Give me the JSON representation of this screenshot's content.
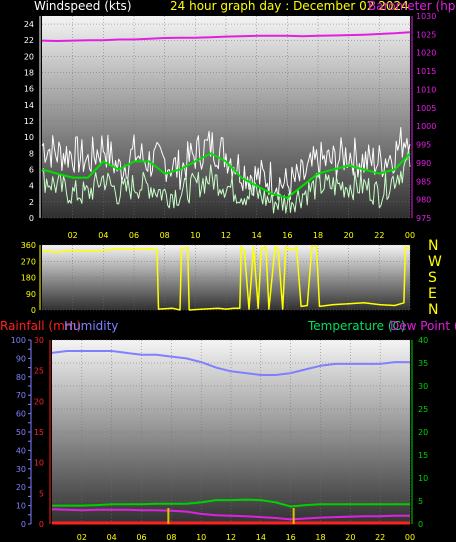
{
  "header": {
    "left_title": "Windspeed (kts)",
    "center_title": "24 hour graph day : December 02 2024",
    "right_title": "Barometer (hpa)"
  },
  "panel3_labels": {
    "rainfall": "Rainfall (mm)",
    "humidity": "Humidity",
    "temperature": "Temperature (C)",
    "dew_point": "Dew Point (C)"
  },
  "x_ticks": [
    "02",
    "04",
    "06",
    "08",
    "10",
    "12",
    "14",
    "16",
    "18",
    "20",
    "22",
    "00"
  ],
  "compass": [
    "N",
    "W",
    "S",
    "E",
    "N"
  ],
  "colors": {
    "wind_gust": "#ffffff",
    "wind_avg": "#c8ffc8",
    "wind_trend": "#00e000",
    "barometer": "#e020e0",
    "direction": "#ffff00",
    "humidity": "#8080ff",
    "temperature": "#00d000",
    "dewpoint": "#e020e0",
    "rainfall": "#ff2020"
  },
  "chart_data": [
    {
      "type": "line",
      "name": "wind-and-barometer",
      "x_hours": [
        0,
        1,
        2,
        3,
        4,
        5,
        6,
        7,
        8,
        9,
        10,
        11,
        12,
        13,
        14,
        15,
        16,
        17,
        18,
        19,
        20,
        21,
        22,
        23,
        24
      ],
      "series": [
        {
          "name": "Windspeed (kts)",
          "axis": "left",
          "values": [
            9,
            8,
            8,
            7,
            9,
            6,
            8,
            7,
            7,
            6,
            8,
            9,
            8,
            6,
            5,
            5,
            4,
            5,
            7,
            7,
            8,
            7,
            7,
            8,
            11
          ]
        },
        {
          "name": "Windspeed (kts)",
          "axis": "left",
          "values": [
            5,
            4,
            3,
            3,
            5,
            3,
            4,
            4,
            3,
            3,
            4,
            5,
            4,
            3,
            3,
            2,
            2,
            3,
            4,
            4,
            4,
            4,
            3,
            5,
            7
          ]
        },
        {
          "name": "Windspeed (kts)",
          "axis": "left",
          "values": [
            6,
            5.5,
            5,
            5,
            7,
            6,
            7,
            7,
            5.5,
            6,
            7,
            8,
            7,
            5,
            4,
            3,
            2.5,
            4,
            5.5,
            6,
            6.5,
            6,
            5.5,
            6,
            8
          ]
        },
        {
          "name": "Barometer (hpa)",
          "axis": "right",
          "values": [
            1023.3,
            1023.2,
            1023.3,
            1023.4,
            1023.4,
            1023.6,
            1023.6,
            1023.8,
            1024.0,
            1024.1,
            1024.1,
            1024.2,
            1024.4,
            1024.5,
            1024.6,
            1024.6,
            1024.6,
            1024.5,
            1024.6,
            1024.7,
            1024.8,
            1024.9,
            1025.1,
            1025.3,
            1025.6
          ]
        }
      ],
      "ylim_left": [
        0,
        25
      ],
      "yticks_left": [
        0,
        2,
        4,
        6,
        8,
        10,
        12,
        14,
        16,
        18,
        20,
        22,
        24
      ],
      "ylim_right": [
        975,
        1030
      ],
      "yticks_right": [
        975,
        980,
        985,
        990,
        995,
        1000,
        1005,
        1010,
        1015,
        1020,
        1025,
        1030
      ]
    },
    {
      "type": "line",
      "name": "wind-direction",
      "series": [
        {
          "name": "Wind direction",
          "values": [
            [
              0,
              330
            ],
            [
              1,
              320
            ],
            [
              2,
              330
            ],
            [
              3,
              325
            ],
            [
              4,
              330
            ],
            [
              5,
              340
            ],
            [
              6,
              335
            ],
            [
              7,
              340
            ],
            [
              7.5,
              335
            ],
            [
              7.6,
              5
            ],
            [
              8.5,
              10
            ],
            [
              9,
              0
            ],
            [
              9.1,
              340
            ],
            [
              9.5,
              345
            ],
            [
              9.6,
              0
            ],
            [
              10.5,
              5
            ],
            [
              11.5,
              10
            ],
            [
              12,
              5
            ],
            [
              12.5,
              10
            ],
            [
              12.9,
              10
            ],
            [
              13,
              350
            ],
            [
              13.2,
              330
            ],
            [
              13.5,
              5
            ],
            [
              13.8,
              350
            ],
            [
              14.1,
              10
            ],
            [
              14.3,
              340
            ],
            [
              14.6,
              350
            ],
            [
              14.8,
              5
            ],
            [
              15.2,
              350
            ],
            [
              15.4,
              340
            ],
            [
              15.7,
              5
            ],
            [
              15.9,
              350
            ],
            [
              16.3,
              330
            ],
            [
              16.6,
              350
            ],
            [
              16.9,
              20
            ],
            [
              17.3,
              25
            ],
            [
              17.6,
              355
            ],
            [
              17.9,
              350
            ],
            [
              18.1,
              20
            ],
            [
              19,
              30
            ],
            [
              20,
              35
            ],
            [
              21,
              40
            ],
            [
              22,
              30
            ],
            [
              23,
              25
            ],
            [
              23.6,
              40
            ],
            [
              23.7,
              350
            ],
            [
              24,
              340
            ]
          ]
        }
      ],
      "ylim": [
        0,
        360
      ],
      "yticks": [
        0,
        90,
        180,
        270,
        360
      ]
    },
    {
      "type": "line",
      "name": "temperature-humidity-rain",
      "x_hours": [
        0,
        1,
        2,
        3,
        4,
        5,
        6,
        7,
        8,
        9,
        10,
        11,
        12,
        13,
        14,
        15,
        16,
        17,
        18,
        19,
        20,
        21,
        22,
        23,
        24
      ],
      "series": [
        {
          "name": "Humidity",
          "axis": "humidity",
          "values": [
            93,
            94,
            94,
            94,
            94,
            93,
            92,
            92,
            91,
            90,
            88,
            85,
            83,
            82,
            81,
            81,
            82,
            84,
            86,
            87,
            87,
            87,
            87,
            88,
            88
          ]
        },
        {
          "name": "Temperature (C)",
          "axis": "temperature",
          "values": [
            4.0,
            4.0,
            4.0,
            4.1,
            4.3,
            4.3,
            4.3,
            4.4,
            4.4,
            4.4,
            4.7,
            5.2,
            5.2,
            5.3,
            5.2,
            4.7,
            3.8,
            4.1,
            4.3,
            4.3,
            4.3,
            4.3,
            4.3,
            4.3,
            4.3
          ]
        },
        {
          "name": "Dew Point (C)",
          "axis": "temperature",
          "values": [
            3.2,
            3.1,
            3.0,
            3.1,
            3.1,
            3.1,
            3.0,
            3.0,
            2.9,
            2.7,
            2.2,
            1.9,
            1.8,
            1.7,
            1.5,
            1.3,
            1.0,
            1.2,
            1.4,
            1.5,
            1.6,
            1.7,
            1.7,
            1.8,
            1.8
          ]
        },
        {
          "name": "Rainfall (mm)",
          "axis": "rain",
          "values": [
            0,
            0,
            0,
            0,
            0,
            0,
            0,
            0,
            0,
            0,
            0,
            0,
            0,
            0,
            0,
            0,
            0,
            0,
            0,
            0,
            0,
            0,
            0,
            0,
            0
          ]
        }
      ],
      "rain_markers_hours": [
        7.8,
        16.2
      ],
      "ylim_humidity": [
        0,
        100
      ],
      "yticks_humidity": [
        0,
        5,
        10,
        15,
        20,
        25,
        30,
        35,
        40,
        45,
        50,
        55,
        60,
        65,
        70,
        75,
        80,
        85,
        90,
        95,
        100
      ],
      "ylim_rain": [
        0,
        30
      ],
      "yticks_rain": [
        0,
        5,
        10,
        15,
        20,
        25,
        30
      ],
      "ylim_temperature": [
        0,
        40
      ],
      "yticks_temperature": [
        0,
        5,
        10,
        15,
        20,
        25,
        30,
        35,
        40
      ]
    }
  ]
}
